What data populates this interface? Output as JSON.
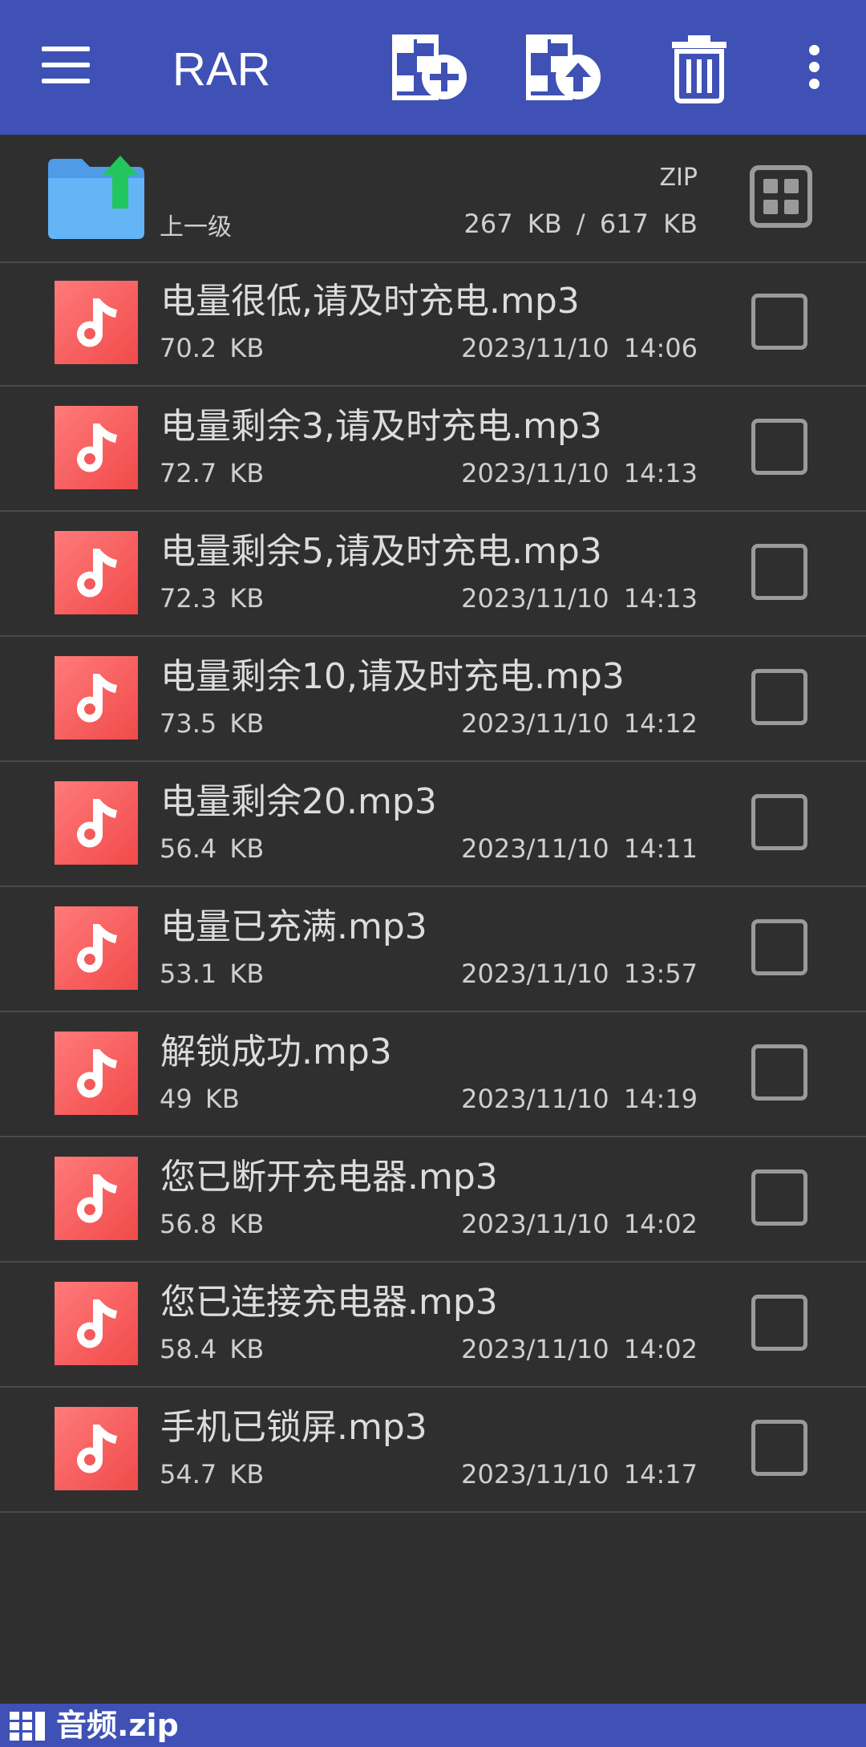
{
  "appbar": {
    "title": "RAR",
    "icons": {
      "menu": "menu-icon",
      "add": "archive-add-icon",
      "extract": "archive-extract-icon",
      "delete": "trash-icon",
      "more": "more-vert-icon"
    },
    "background": "#3f51b5"
  },
  "parent": {
    "label": "上一级",
    "type": "ZIP",
    "size": "267 KB / 617 KB"
  },
  "files": [
    {
      "name": "电量很低,请及时充电.mp3",
      "size": "70.2 KB",
      "date": "2023/11/10 14:06"
    },
    {
      "name": "电量剩余3,请及时充电.mp3",
      "size": "72.7 KB",
      "date": "2023/11/10 14:13"
    },
    {
      "name": "电量剩余5,请及时充电.mp3",
      "size": "72.3 KB",
      "date": "2023/11/10 14:13"
    },
    {
      "name": "电量剩余10,请及时充电.mp3",
      "size": "73.5 KB",
      "date": "2023/11/10 14:12"
    },
    {
      "name": "电量剩余20.mp3",
      "size": "56.4 KB",
      "date": "2023/11/10 14:11"
    },
    {
      "name": "电量已充满.mp3",
      "size": "53.1 KB",
      "date": "2023/11/10 13:57"
    },
    {
      "name": "解锁成功.mp3",
      "size": "49 KB",
      "date": "2023/11/10 14:19"
    },
    {
      "name": "您已断开充电器.mp3",
      "size": "56.8 KB",
      "date": "2023/11/10 14:02"
    },
    {
      "name": "您已连接充电器.mp3",
      "size": "58.4 KB",
      "date": "2023/11/10 14:02"
    },
    {
      "name": "手机已锁屏.mp3",
      "size": "54.7 KB",
      "date": "2023/11/10 14:17"
    }
  ],
  "statusbar": {
    "archive_name": "音频.zip"
  },
  "colors": {
    "accent": "#3f51b5",
    "background": "#2f2f2f",
    "music_icon": "#f45a5a",
    "folder": "#5aa9f0",
    "upload_arrow": "#22c55e"
  }
}
